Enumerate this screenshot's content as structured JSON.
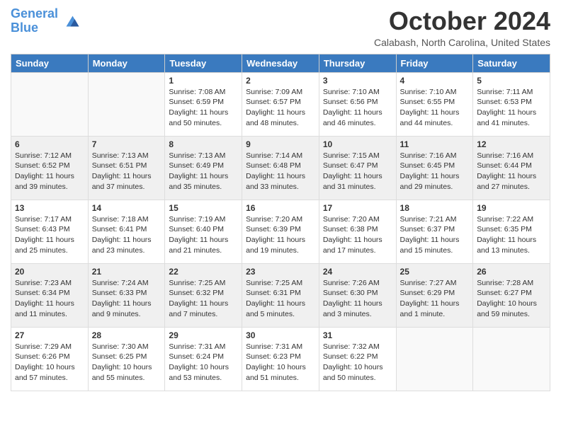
{
  "header": {
    "logo_line1": "General",
    "logo_line2": "Blue",
    "month": "October 2024",
    "location": "Calabash, North Carolina, United States"
  },
  "days_of_week": [
    "Sunday",
    "Monday",
    "Tuesday",
    "Wednesday",
    "Thursday",
    "Friday",
    "Saturday"
  ],
  "weeks": [
    [
      {
        "day": "",
        "info": ""
      },
      {
        "day": "",
        "info": ""
      },
      {
        "day": "1",
        "info": "Sunrise: 7:08 AM\nSunset: 6:59 PM\nDaylight: 11 hours and 50 minutes."
      },
      {
        "day": "2",
        "info": "Sunrise: 7:09 AM\nSunset: 6:57 PM\nDaylight: 11 hours and 48 minutes."
      },
      {
        "day": "3",
        "info": "Sunrise: 7:10 AM\nSunset: 6:56 PM\nDaylight: 11 hours and 46 minutes."
      },
      {
        "day": "4",
        "info": "Sunrise: 7:10 AM\nSunset: 6:55 PM\nDaylight: 11 hours and 44 minutes."
      },
      {
        "day": "5",
        "info": "Sunrise: 7:11 AM\nSunset: 6:53 PM\nDaylight: 11 hours and 41 minutes."
      }
    ],
    [
      {
        "day": "6",
        "info": "Sunrise: 7:12 AM\nSunset: 6:52 PM\nDaylight: 11 hours and 39 minutes."
      },
      {
        "day": "7",
        "info": "Sunrise: 7:13 AM\nSunset: 6:51 PM\nDaylight: 11 hours and 37 minutes."
      },
      {
        "day": "8",
        "info": "Sunrise: 7:13 AM\nSunset: 6:49 PM\nDaylight: 11 hours and 35 minutes."
      },
      {
        "day": "9",
        "info": "Sunrise: 7:14 AM\nSunset: 6:48 PM\nDaylight: 11 hours and 33 minutes."
      },
      {
        "day": "10",
        "info": "Sunrise: 7:15 AM\nSunset: 6:47 PM\nDaylight: 11 hours and 31 minutes."
      },
      {
        "day": "11",
        "info": "Sunrise: 7:16 AM\nSunset: 6:45 PM\nDaylight: 11 hours and 29 minutes."
      },
      {
        "day": "12",
        "info": "Sunrise: 7:16 AM\nSunset: 6:44 PM\nDaylight: 11 hours and 27 minutes."
      }
    ],
    [
      {
        "day": "13",
        "info": "Sunrise: 7:17 AM\nSunset: 6:43 PM\nDaylight: 11 hours and 25 minutes."
      },
      {
        "day": "14",
        "info": "Sunrise: 7:18 AM\nSunset: 6:41 PM\nDaylight: 11 hours and 23 minutes."
      },
      {
        "day": "15",
        "info": "Sunrise: 7:19 AM\nSunset: 6:40 PM\nDaylight: 11 hours and 21 minutes."
      },
      {
        "day": "16",
        "info": "Sunrise: 7:20 AM\nSunset: 6:39 PM\nDaylight: 11 hours and 19 minutes."
      },
      {
        "day": "17",
        "info": "Sunrise: 7:20 AM\nSunset: 6:38 PM\nDaylight: 11 hours and 17 minutes."
      },
      {
        "day": "18",
        "info": "Sunrise: 7:21 AM\nSunset: 6:37 PM\nDaylight: 11 hours and 15 minutes."
      },
      {
        "day": "19",
        "info": "Sunrise: 7:22 AM\nSunset: 6:35 PM\nDaylight: 11 hours and 13 minutes."
      }
    ],
    [
      {
        "day": "20",
        "info": "Sunrise: 7:23 AM\nSunset: 6:34 PM\nDaylight: 11 hours and 11 minutes."
      },
      {
        "day": "21",
        "info": "Sunrise: 7:24 AM\nSunset: 6:33 PM\nDaylight: 11 hours and 9 minutes."
      },
      {
        "day": "22",
        "info": "Sunrise: 7:25 AM\nSunset: 6:32 PM\nDaylight: 11 hours and 7 minutes."
      },
      {
        "day": "23",
        "info": "Sunrise: 7:25 AM\nSunset: 6:31 PM\nDaylight: 11 hours and 5 minutes."
      },
      {
        "day": "24",
        "info": "Sunrise: 7:26 AM\nSunset: 6:30 PM\nDaylight: 11 hours and 3 minutes."
      },
      {
        "day": "25",
        "info": "Sunrise: 7:27 AM\nSunset: 6:29 PM\nDaylight: 11 hours and 1 minute."
      },
      {
        "day": "26",
        "info": "Sunrise: 7:28 AM\nSunset: 6:27 PM\nDaylight: 10 hours and 59 minutes."
      }
    ],
    [
      {
        "day": "27",
        "info": "Sunrise: 7:29 AM\nSunset: 6:26 PM\nDaylight: 10 hours and 57 minutes."
      },
      {
        "day": "28",
        "info": "Sunrise: 7:30 AM\nSunset: 6:25 PM\nDaylight: 10 hours and 55 minutes."
      },
      {
        "day": "29",
        "info": "Sunrise: 7:31 AM\nSunset: 6:24 PM\nDaylight: 10 hours and 53 minutes."
      },
      {
        "day": "30",
        "info": "Sunrise: 7:31 AM\nSunset: 6:23 PM\nDaylight: 10 hours and 51 minutes."
      },
      {
        "day": "31",
        "info": "Sunrise: 7:32 AM\nSunset: 6:22 PM\nDaylight: 10 hours and 50 minutes."
      },
      {
        "day": "",
        "info": ""
      },
      {
        "day": "",
        "info": ""
      }
    ]
  ]
}
